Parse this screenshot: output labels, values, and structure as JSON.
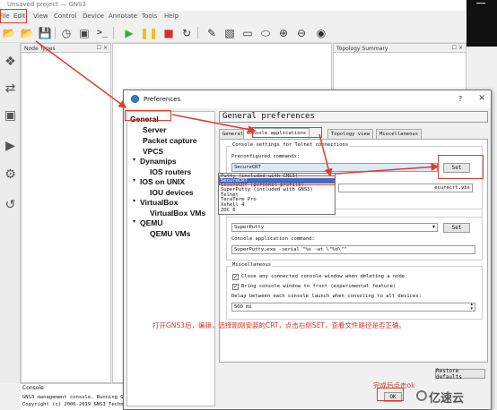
{
  "app": {
    "title": "Unsaved project — GNS3"
  },
  "menu": [
    "File",
    "Edit",
    "View",
    "Control",
    "Device",
    "Annotate",
    "Tools",
    "Help"
  ],
  "panels": {
    "node_types": "Node Types",
    "topology_summary": "Topology Summary",
    "console": {
      "title": "Console",
      "line1": "GNS3 management console. Running GN",
      "line2": "Copyright (c) 2006-2019 GNS3 Technol"
    }
  },
  "dialog": {
    "title": "Preferences",
    "help": "?",
    "close": "×",
    "heading": "General preferences",
    "nav": [
      {
        "label": "General"
      },
      {
        "label": "Server"
      },
      {
        "label": "Packet capture"
      },
      {
        "label": "VPCS"
      },
      {
        "label": "Dynamips",
        "expander": "▾"
      },
      {
        "label": "IOS routers"
      },
      {
        "label": "IOS on UNIX",
        "expander": "▾"
      },
      {
        "label": "IOU devices"
      },
      {
        "label": "VirtualBox",
        "expander": "▾"
      },
      {
        "label": "VirtualBox VMs"
      },
      {
        "label": "QEMU",
        "expander": "▾"
      },
      {
        "label": "QEMU VMs"
      }
    ],
    "tabs": [
      "General",
      "Console applications",
      "Topology view",
      "Miscellaneous"
    ],
    "telnet_group": "Console settings for Telnet connections",
    "preconfigured_label": "Preconfigured commands:",
    "preconfigured_value": "SecureCRT",
    "dropdown_options": [
      "Putty (included with GNS3)",
      "SecureCRT",
      "SecureCRT (personal profile)",
      "SuperPutty (included with GNS3)",
      "Telnet",
      "TeraTerm Pro",
      "Xshell 4",
      "ZOC 6"
    ],
    "set_button": "Set",
    "path_tail": "ecurecrt.vbs",
    "serial_value": "SuperPutty",
    "set_button2": "Set",
    "app_command_label": "Console application command:",
    "app_command_value": "SuperPutty.exe -serial \"%s -wt \\\"%d\\\"\"",
    "misc_group": "Miscellaneous",
    "checkbox1": "Close any connected console window when deleting a node",
    "checkbox2": "Bring console window to front (experimental feature)",
    "delay_label": "Delay between each console launch when consoling to all devices:",
    "delay_value": "500 ms",
    "restore_button": "Restore defaults",
    "ok_button": "OK"
  },
  "annotations": {
    "note": "打开GNS3后，编辑，选择刚刚安装的CRT，点击右侧SET，查看文件路径是否正确。",
    "done": "完成后点击ok",
    "color": "#d2382b"
  },
  "watermark": "亿速云"
}
